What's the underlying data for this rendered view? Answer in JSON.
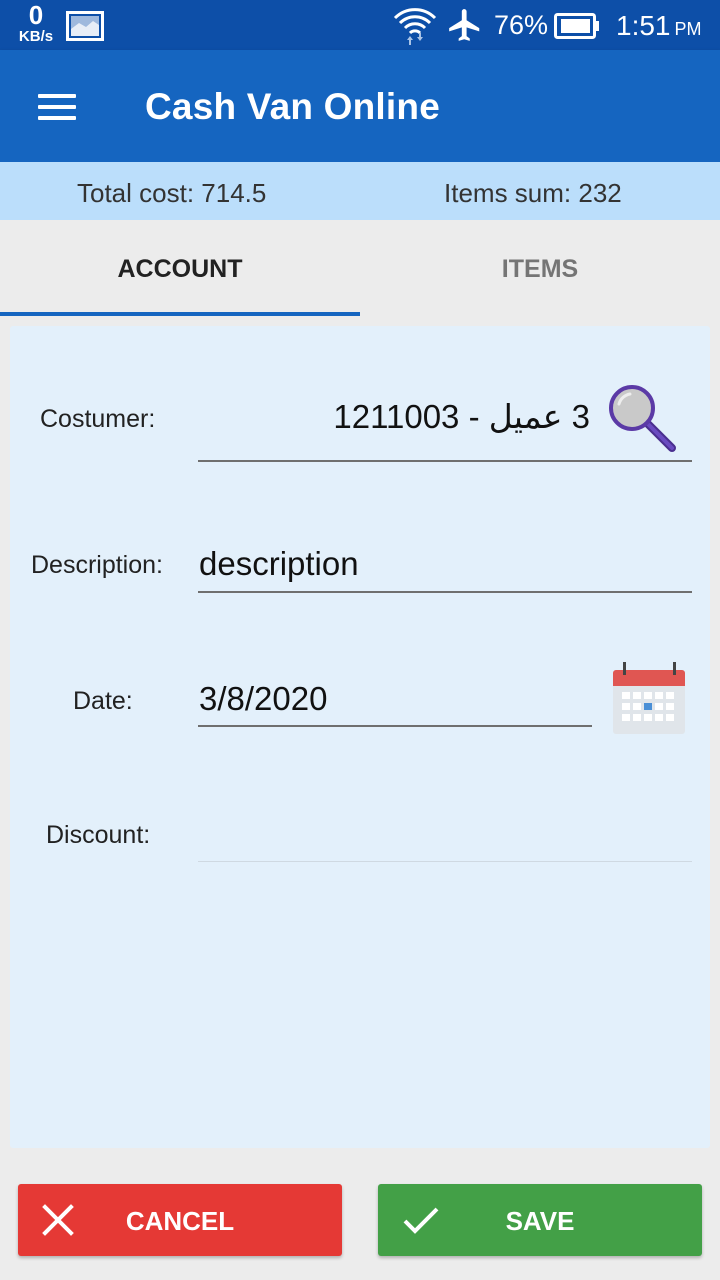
{
  "status_bar": {
    "net_speed_value": "0",
    "net_speed_unit": "KB/s",
    "battery_percent": "76%",
    "time": "1:51",
    "ampm": "PM",
    "icons": [
      "image-notification-icon",
      "wifi-icon",
      "airplane-mode-icon",
      "battery-icon"
    ]
  },
  "app_bar": {
    "title": "Cash Van Online",
    "menu_icon": "hamburger-menu-icon"
  },
  "summary": {
    "total_cost_label": "Total cost:",
    "total_cost_value": "714.5",
    "items_sum_label": "Items sum:",
    "items_sum_value": "232"
  },
  "tabs": [
    {
      "label": "ACCOUNT",
      "selected": true
    },
    {
      "label": "ITEMS",
      "selected": false
    }
  ],
  "form": {
    "customer": {
      "label": "Costumer:",
      "value": "3 عميل - 1211003",
      "icon": "search-magnifier-icon"
    },
    "description": {
      "label": "Description:",
      "value": "description"
    },
    "date": {
      "label": "Date:",
      "value": "3/8/2020",
      "icon": "calendar-icon"
    },
    "discount": {
      "label": "Discount:",
      "value": ""
    }
  },
  "actions": {
    "cancel_label": "CANCEL",
    "save_label": "SAVE"
  },
  "colors": {
    "status_bar": "#0d4fa8",
    "app_bar": "#1565c0",
    "summary_bg": "#bbdefb",
    "card_bg": "#e3f0fb",
    "cancel": "#e53935",
    "save": "#43a047"
  }
}
